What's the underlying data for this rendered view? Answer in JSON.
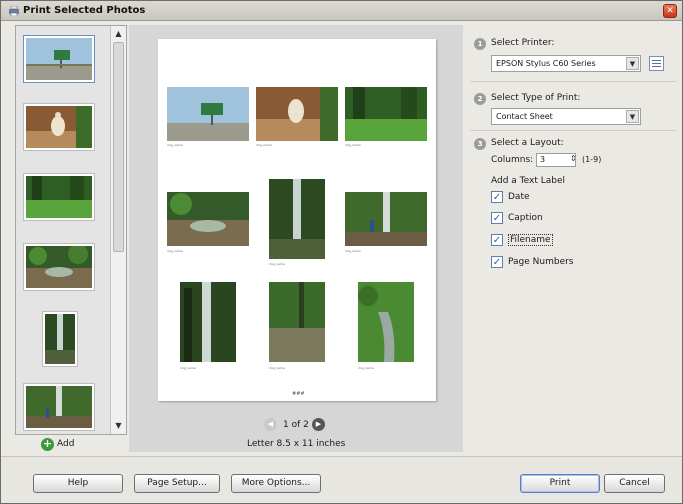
{
  "window": {
    "title": "Print Selected Photos"
  },
  "thumbnails": [
    {
      "name": "highway-sign",
      "selected": true
    },
    {
      "name": "bird"
    },
    {
      "name": "green-field"
    },
    {
      "name": "stream"
    },
    {
      "name": "waterfall-tall"
    },
    {
      "name": "waterfall-person"
    }
  ],
  "add_label": "Add",
  "preview": {
    "page_indicator": "1 of 2",
    "paper": "Letter  8.5 x 11 inches",
    "caption_text": "img_name",
    "page_number": "###"
  },
  "settings": {
    "step1": {
      "number": "1",
      "label": "Select Printer:",
      "value": "EPSON Stylus C60 Series"
    },
    "step2": {
      "number": "2",
      "label": "Select Type of Print:",
      "value": "Contact Sheet"
    },
    "step3": {
      "number": "3",
      "label": "Select a Layout:",
      "columns_label": "Columns:",
      "columns_value": "3",
      "columns_range": "(1-9)",
      "text_label": "Add a Text Label",
      "checkboxes": [
        {
          "label": "Date",
          "checked": true
        },
        {
          "label": "Caption",
          "checked": true
        },
        {
          "label": "Filename",
          "checked": true
        },
        {
          "label": "Page Numbers",
          "checked": true
        }
      ]
    }
  },
  "buttons": {
    "help": "Help",
    "page_setup": "Page Setup...",
    "more_options": "More Options...",
    "print": "Print",
    "cancel": "Cancel"
  },
  "colors": {
    "dialog_bg": "#ebe9e4",
    "preview_bg": "#d6d6d6",
    "check": "#2e5da6",
    "add_green": "#3b9a3b",
    "close_red": "#c8331c"
  }
}
